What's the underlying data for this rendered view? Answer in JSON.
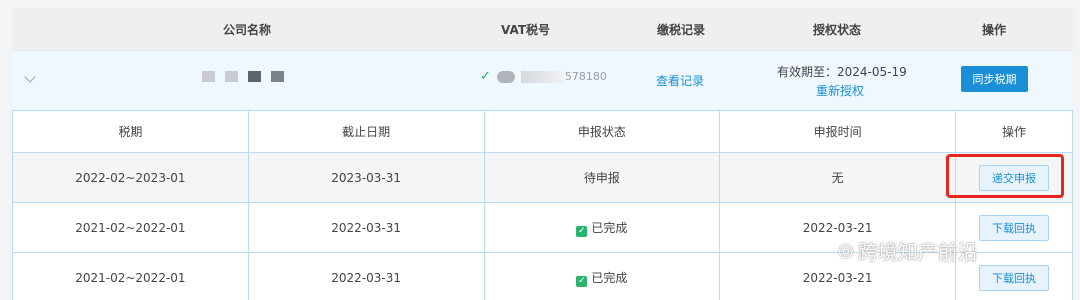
{
  "header": {
    "company_name": "公司名称",
    "vat_number": "VAT税号",
    "tax_records": "缴税记录",
    "auth_status": "授权状态",
    "actions": "操作"
  },
  "company": {
    "vat_visible": "578180",
    "view_records": "查看记录",
    "valid_until": "有效期至：2024-05-19",
    "reauthorize": "重新授权",
    "sync_button": "同步税期"
  },
  "periods_table": {
    "columns": [
      "税期",
      "截止日期",
      "申报状态",
      "申报时间",
      "操作"
    ],
    "rows": [
      {
        "period": "2022-02~2023-01",
        "deadline": "2023-03-31",
        "status": "待申报",
        "filed_at": "无",
        "action": "递交申报"
      },
      {
        "period": "2021-02~2022-01",
        "deadline": "2022-03-31",
        "status": "已完成",
        "filed_at": "2022-03-21",
        "action": "下载回执"
      },
      {
        "period": "2021-02~2022-01",
        "deadline": "2022-03-31",
        "status": "已完成",
        "filed_at": "2022-03-21",
        "action": "下载回执"
      }
    ]
  },
  "watermark": "跨境知产前沿",
  "icons": {
    "expand": "chevron-down-icon",
    "verified": "check-icon",
    "completed": "check-square-icon",
    "watermark": "wechat-icon"
  },
  "colors": {
    "accent": "#1a8fd8",
    "success": "#2ab36b",
    "highlight": "#e8251d"
  }
}
